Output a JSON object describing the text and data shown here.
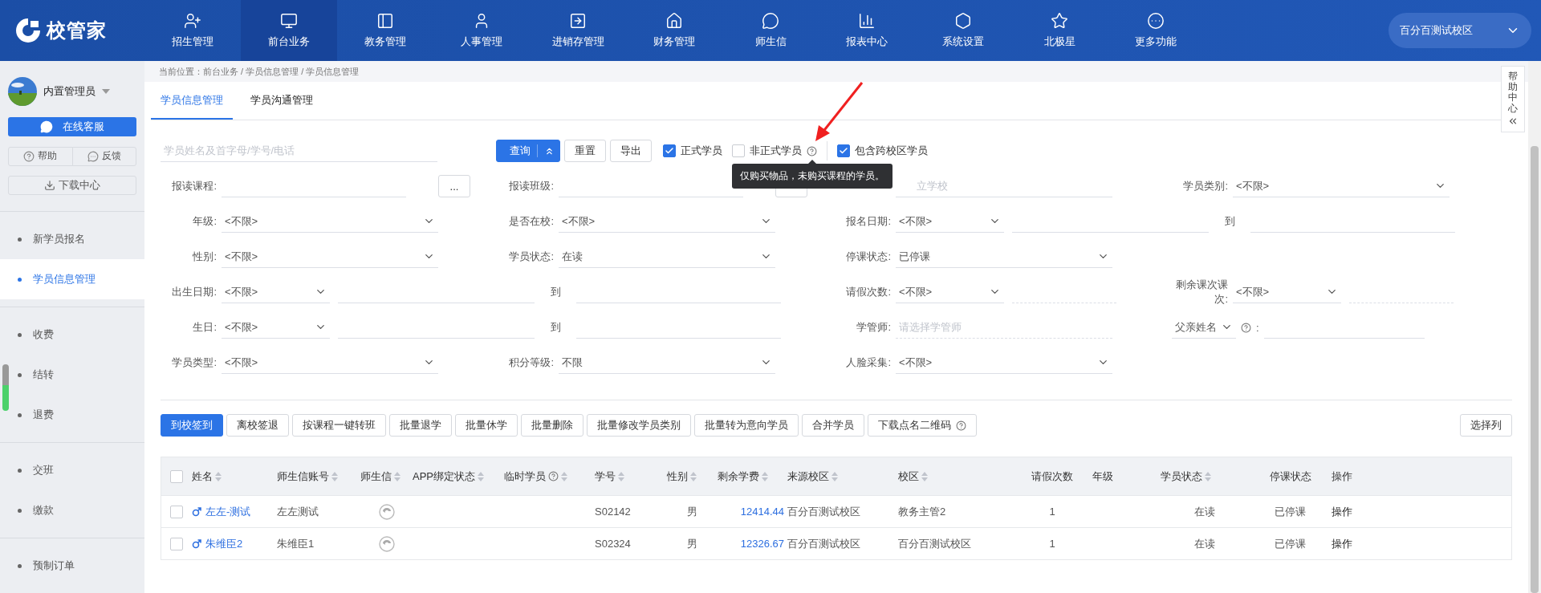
{
  "logo": {
    "text": "校管家"
  },
  "nav": [
    {
      "label": "招生管理",
      "selected": false
    },
    {
      "label": "前台业务",
      "selected": true
    },
    {
      "label": "教务管理",
      "selected": false
    },
    {
      "label": "人事管理",
      "selected": false
    },
    {
      "label": "进销存管理",
      "selected": false
    },
    {
      "label": "财务管理",
      "selected": false
    },
    {
      "label": "师生信",
      "selected": false
    },
    {
      "label": "报表中心",
      "selected": false
    },
    {
      "label": "系统设置",
      "selected": false
    },
    {
      "label": "北极星",
      "selected": false
    },
    {
      "label": "更多功能",
      "selected": false
    }
  ],
  "campus": {
    "value": "百分百测试校区"
  },
  "sidebar": {
    "user": "内置管理员",
    "service_button": "在线客服",
    "help_buttons": [
      "帮助",
      "反馈"
    ],
    "download_button": "下载中心",
    "groups": [
      [
        {
          "label": "新学员报名",
          "selected": false
        },
        {
          "label": "学员信息管理",
          "selected": true
        }
      ],
      [
        {
          "label": "收费",
          "selected": false
        },
        {
          "label": "结转",
          "selected": false
        },
        {
          "label": "退费",
          "selected": false
        }
      ],
      [
        {
          "label": "交班",
          "selected": false
        },
        {
          "label": "缴款",
          "selected": false
        }
      ],
      [
        {
          "label": "预制订单",
          "selected": false
        }
      ]
    ]
  },
  "breadcrumb": "当前位置：前台业务 / 学员信息管理 / 学员信息管理",
  "tabs": [
    {
      "label": "学员信息管理",
      "selected": true
    },
    {
      "label": "学员沟通管理",
      "selected": false
    }
  ],
  "help_center": {
    "label": "帮助中心"
  },
  "search": {
    "placeholder": "学员姓名及首字母/学号/电话"
  },
  "search_buttons": [
    {
      "label": "查询",
      "kind": "primary"
    },
    {
      "label": "重置",
      "kind": "plain"
    },
    {
      "label": "导出",
      "kind": "plain"
    }
  ],
  "checkboxes": [
    {
      "label": "正式学员",
      "checked": true,
      "help": false
    },
    {
      "label": "非正式学员",
      "checked": false,
      "help": true,
      "tooltip": "仅购买物品，未购买课程的学员。"
    },
    {
      "label": "包含跨校区学员",
      "checked": true,
      "help": false
    }
  ],
  "filters": [
    [
      {
        "kind": "picker",
        "label": "报读课程:",
        "button": "..."
      },
      {
        "kind": "picker",
        "label": "报读班级:"
      },
      {
        "kind": "text",
        "placeholder": "立学校"
      },
      {
        "kind": "select",
        "label": "学员类别:",
        "value": "<不限>"
      }
    ],
    [
      {
        "kind": "select",
        "label": "年级:",
        "value": "<不限>"
      },
      {
        "kind": "select",
        "label": "是否在校:",
        "value": "<不限>"
      },
      {
        "kind": "range",
        "label": "报名日期:",
        "value": "<不限>",
        "to": "到"
      }
    ],
    [
      {
        "kind": "select",
        "label": "性别:",
        "value": "<不限>"
      },
      {
        "kind": "select",
        "label": "学员状态:",
        "value": "在读"
      },
      {
        "kind": "select",
        "label": "停课状态:",
        "value": "已停课"
      },
      {
        "kind": "blank"
      }
    ],
    [
      {
        "kind": "range",
        "label": "出生日期:",
        "value": "<不限>",
        "to": "到"
      },
      {
        "kind": "count",
        "label": "请假次数:",
        "value": "<不限>"
      },
      {
        "kind": "count",
        "label": "剩余课次课次:",
        "value": "<不限>"
      }
    ],
    [
      {
        "kind": "range",
        "label": "生日:",
        "value": "<不限>",
        "to": "到"
      },
      {
        "kind": "selector",
        "label": "学管师:",
        "placeholder": "请选择学管师"
      },
      {
        "kind": "dropdown-label",
        "value": "父亲姓名",
        "separator": ":"
      }
    ],
    [
      {
        "kind": "select",
        "label": "学员类型:",
        "value": "<不限>"
      },
      {
        "kind": "select",
        "label": "积分等级:",
        "value": "不限"
      },
      {
        "kind": "select",
        "label": "人脸采集:",
        "value": "<不限>"
      },
      {
        "kind": "blank"
      }
    ]
  ],
  "actions": [
    {
      "label": "到校签到",
      "kind": "primary",
      "help": false
    },
    {
      "label": "离校签退",
      "kind": "plain",
      "help": false
    },
    {
      "label": "按课程一键转班",
      "kind": "plain",
      "help": false
    },
    {
      "label": "批量退学",
      "kind": "plain",
      "help": false
    },
    {
      "label": "批量休学",
      "kind": "plain",
      "help": false
    },
    {
      "label": "批量删除",
      "kind": "plain",
      "help": false
    },
    {
      "label": "批量修改学员类别",
      "kind": "plain",
      "help": false
    },
    {
      "label": "批量转为意向学员",
      "kind": "plain",
      "help": false
    },
    {
      "label": "合并学员",
      "kind": "plain",
      "help": false
    },
    {
      "label": "下载点名二维码",
      "kind": "plain",
      "help": true
    }
  ],
  "column_button": "选择列",
  "table": {
    "all_selected": false,
    "columns": [
      {
        "label": "姓名",
        "kind": "name",
        "sortable": true,
        "help": false
      },
      {
        "label": "师生信账号",
        "kind": "text",
        "sortable": true,
        "help": false
      },
      {
        "label": "师生信",
        "kind": "icon",
        "sortable": true,
        "help": false
      },
      {
        "label": "APP绑定状态",
        "kind": "empty",
        "sortable": true,
        "help": false
      },
      {
        "label": "临时学员",
        "kind": "empty",
        "sortable": true,
        "help": true
      },
      {
        "label": "学号",
        "kind": "text",
        "sortable": true,
        "help": false
      },
      {
        "label": "性别",
        "kind": "center",
        "sortable": true,
        "help": false
      },
      {
        "label": "剩余学费",
        "kind": "money",
        "sortable": true,
        "help": false
      },
      {
        "label": "来源校区",
        "kind": "text",
        "sortable": true,
        "help": false
      },
      {
        "label": "校区",
        "kind": "text",
        "sortable": true,
        "help": false
      },
      {
        "label": "请假次数",
        "kind": "center",
        "sortable": false,
        "help": false
      },
      {
        "label": "年级",
        "kind": "empty",
        "sortable": false,
        "help": false
      },
      {
        "label": "学员状态",
        "kind": "center",
        "sortable": true,
        "help": false
      },
      {
        "label": "停课状态",
        "kind": "center",
        "sortable": false,
        "help": false
      },
      {
        "label": "操作",
        "kind": "action",
        "sortable": false,
        "help": false
      }
    ],
    "rows": [
      {
        "selected": false,
        "cells": [
          "左左-测试",
          "左左测试",
          "",
          "",
          "",
          "S02142",
          "男",
          "12414.44",
          "百分百测试校区",
          "教务主管2",
          "1",
          "",
          "在读",
          "已停课",
          "操作"
        ]
      },
      {
        "selected": false,
        "cells": [
          "朱维臣2",
          "朱维臣1",
          "",
          "",
          "",
          "S02324",
          "男",
          "12326.67",
          "百分百测试校区",
          "百分百测试校区",
          "1",
          "",
          "在读",
          "已停课",
          "操作"
        ]
      }
    ]
  }
}
